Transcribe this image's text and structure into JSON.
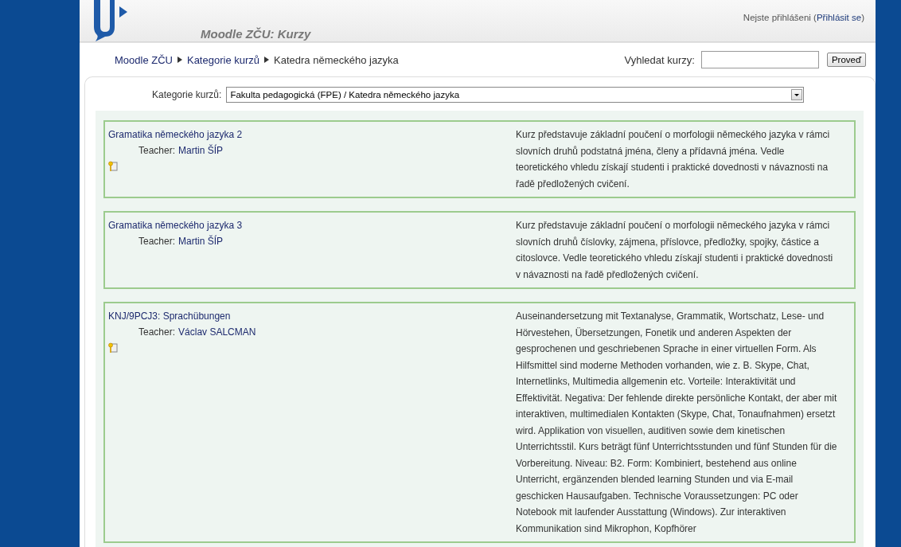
{
  "header": {
    "site_title": "Moodle ZČU: Kurzy",
    "login_status": "Nejste přihlášeni (",
    "login_link": "Přihlásit se",
    "login_close": ")"
  },
  "breadcrumb": [
    "Moodle ZČU",
    "Kategorie kurzů",
    "Katedra německého jazyka"
  ],
  "search": {
    "label": "Vyhledat kurzy:",
    "button": "Proveď"
  },
  "category": {
    "label": "Kategorie kurzů:",
    "value": "Fakulta pedagogická (FPE) / Katedra německého jazyka"
  },
  "courses": [
    {
      "name": "Gramatika německého jazyka 2",
      "teacher_label": "Teacher:",
      "teacher": "Martin ŠÍP",
      "enrolment_key": true,
      "summary": "Kurz představuje základní poučení o morfologii německého jazyka v rámci slovních druhů podstatná jména, členy a přídavná jména. Vedle teoretického vhledu získají studenti i praktické dovednosti v návaznosti na řadě předložených cvičení."
    },
    {
      "name": "Gramatika německého jazyka 3",
      "teacher_label": "Teacher:",
      "teacher": "Martin ŠÍP",
      "enrolment_key": false,
      "summary": "Kurz představuje základní poučení o morfologii německého jazyka v rámci slovních druhů číslovky, zájmena, příslovce, předložky, spojky, částice a citoslovce. Vedle teoretického vhledu získají studenti i praktické dovednosti v návaznosti na řadě předložených cvičení."
    },
    {
      "name": "KNJ/9PCJ3: Sprachübungen",
      "teacher_label": "Teacher:",
      "teacher": "Václav SALCMAN",
      "enrolment_key": true,
      "summary": "Auseinandersetzung mit Textanalyse, Grammatik, Wortschatz, Lese- und Hörvestehen, Übersetzungen, Fonetik und anderen Aspekten der gesprochenen und geschriebenen Sprache in einer virtuellen Form. Als Hilfsmittel sind moderne Methoden vorhanden, wie z. B. Skype, Chat, Internetlinks, Multimedia allgemenin etc. Vorteile: Interaktivität und Effektivität. Negativa: Der fehlende direkte persönliche Kontakt, der aber mit interaktiven, multimedialen Kontakten (Skype, Chat, Tonaufnahmen) ersetzt wird. Applikation von visuellen, auditiven sowie dem kinetischen Unterrichtsstil. Kurs beträgt fünf Unterrichtsstunden und fünf Stunden für die Vorbereitung. Niveau: B2. Form: Kombiniert, bestehend aus online Unterricht, ergänzenden blended learning Stunden und via E-mail geschicken Hausaufgaben. Technische Voraussetzungen: PC oder Notebook mit laufender Ausstattung (Windows). Zur interaktiven Kommunikation sind Mikrophon, Kopfhörer"
    }
  ]
}
